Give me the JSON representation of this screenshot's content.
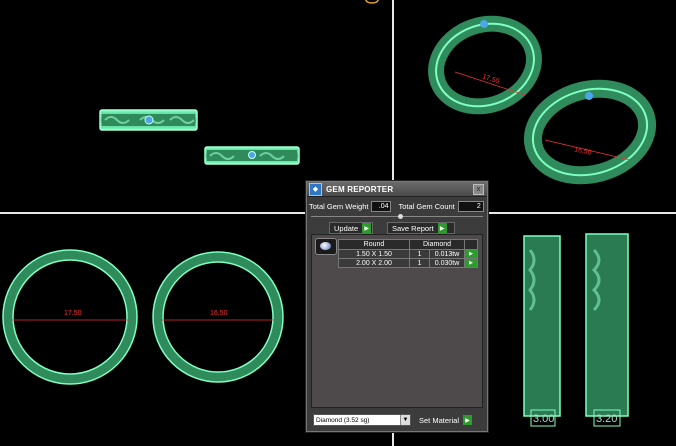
{
  "viewports": {
    "top_left": {
      "description": "Front view of two rings"
    },
    "top_right": {
      "size_label_1": "17.50",
      "size_label_2": "16.50"
    },
    "bottom_left": {
      "size_label_1": "17.50",
      "size_label_2": "16.50"
    },
    "bottom_right": {
      "width_label_1": "3.00",
      "width_label_2": "3.20"
    }
  },
  "panel": {
    "title": "GEM REPORTER",
    "close_label": "x",
    "total_weight_label": "Total Gem Weight",
    "total_weight_value": ".04",
    "total_count_label": "Total Gem Count",
    "total_count_value": "2",
    "update_label": "Update",
    "save_report_label": "Save Report",
    "table": {
      "headers": [
        "Round",
        "Diamond"
      ],
      "rows": [
        {
          "size": "1.50 X 1.50",
          "count": "1",
          "weight": "0.013tw"
        },
        {
          "size": "2.00 X 2.00",
          "count": "1",
          "weight": "0.030tw"
        }
      ]
    },
    "material_select": "Diamond      (3.52 sg)",
    "set_material_label": "Set Material"
  },
  "colors": {
    "ring_green": "#3fbf8a",
    "accent_green": "#2e9b2e",
    "dimension_red": "#e33"
  }
}
